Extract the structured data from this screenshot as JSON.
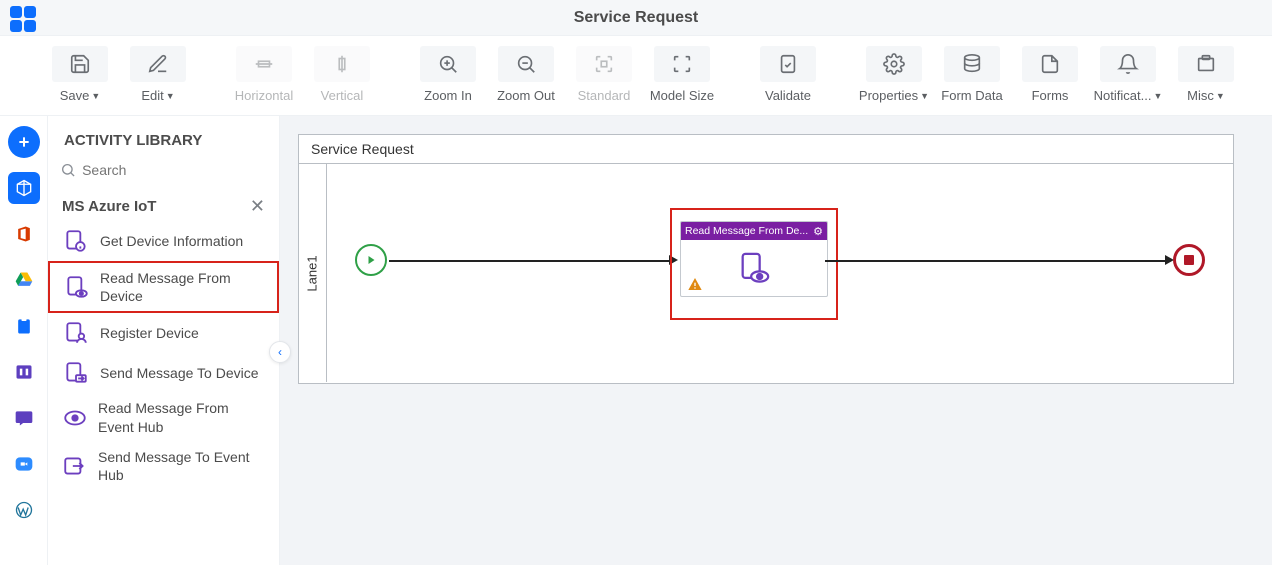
{
  "header": {
    "title": "Service Request"
  },
  "toolbar": {
    "save": "Save",
    "edit": "Edit",
    "horizontal": "Horizontal",
    "vertical": "Vertical",
    "zoom_in": "Zoom In",
    "zoom_out": "Zoom Out",
    "standard": "Standard",
    "model_size": "Model Size",
    "validate": "Validate",
    "properties": "Properties",
    "form_data": "Form Data",
    "forms": "Forms",
    "notifications": "Notificat...",
    "misc": "Misc"
  },
  "sidebar": {
    "title": "ACTIVITY LIBRARY",
    "search_placeholder": "Search",
    "category": "MS Azure IoT",
    "items": [
      {
        "label": "Get Device Information"
      },
      {
        "label": "Read Message From Device"
      },
      {
        "label": "Register Device"
      },
      {
        "label": "Send Message To Device"
      },
      {
        "label": "Read Message From Event Hub"
      },
      {
        "label": "Send Message To Event Hub"
      }
    ]
  },
  "canvas": {
    "process_name": "Service Request",
    "lane_name": "Lane1",
    "task_title": "Read Message From De..."
  }
}
